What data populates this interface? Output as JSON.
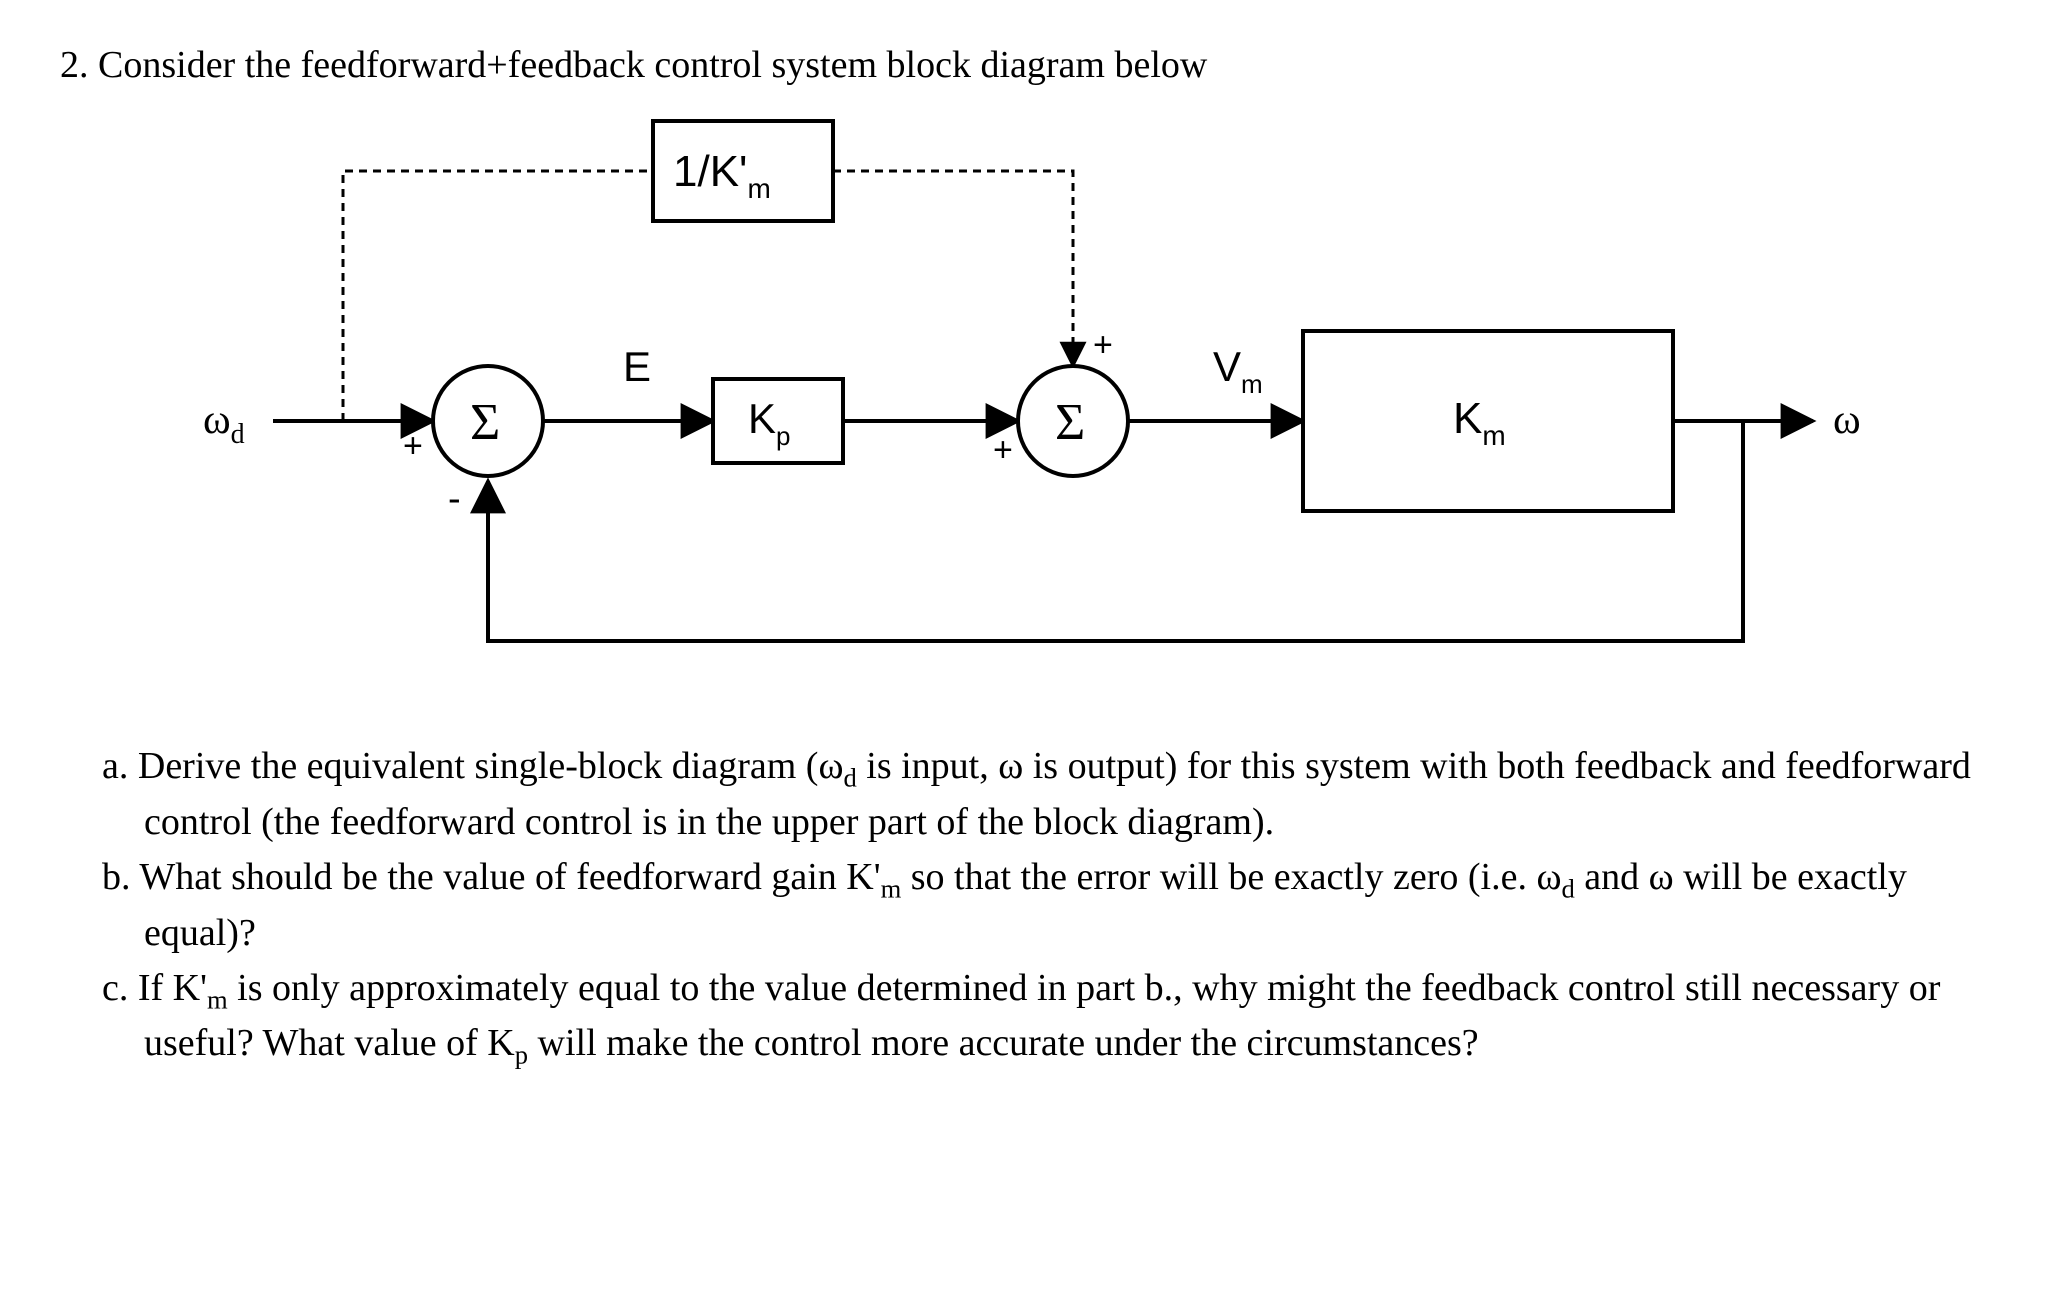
{
  "question_number": "2.",
  "prompt": "Consider the feedforward+feedback control system block diagram below",
  "diagram": {
    "input_label": "ω",
    "input_sub": "d",
    "output_label": "ω",
    "ff_block": "1/K'",
    "ff_block_sub": "m",
    "sum1": "Σ",
    "sum1_sign_top": "+",
    "sum1_sign_bottom": "-",
    "error_label": "E",
    "kp_block": "K",
    "kp_block_sub": "p",
    "sum2": "Σ",
    "sum2_sign_top": "+",
    "sum2_sign_left": "+",
    "vm_label": "V",
    "vm_sub": "m",
    "km_block": "K",
    "km_block_sub": "m"
  },
  "parts": {
    "a": {
      "letter": "a.",
      "text_before_wd": "Derive the equivalent single-block diagram (",
      "wd": "ω",
      "wd_sub": "d",
      "text_mid": " is input, ω is output) for this system with both feedback and feedforward control (the feedforward control is in the upper part of the block diagram)."
    },
    "b": {
      "letter": "b.",
      "text_before": "What should be the value of feedforward gain K'",
      "km_sub": "m",
      "text_mid": " so that the error will be exactly zero (i.e. ω",
      "wd_sub": "d",
      "text_after": " and ω will be exactly equal)?"
    },
    "c": {
      "letter": "c.",
      "text_before": "If K'",
      "km_sub": "m",
      "text_mid": " is only approximately equal to the value determined in part b., why might the feedback control still necessary or useful? What value of K",
      "kp_sub": "p",
      "text_after": " will make the control more accurate under the circumstances?"
    }
  }
}
